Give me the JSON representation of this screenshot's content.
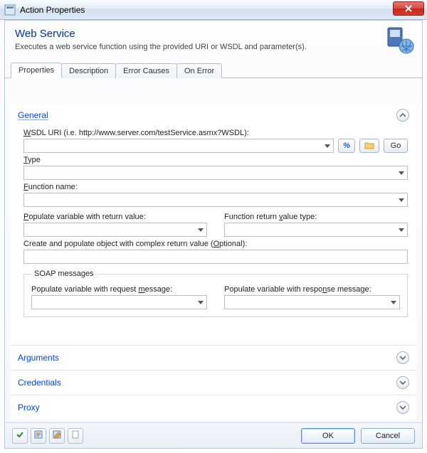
{
  "window": {
    "title": "Action Properties"
  },
  "header": {
    "title": "Web Service",
    "description": "Executes a web service function using the provided URI or WSDL and parameter(s)."
  },
  "tabs": [
    "Properties",
    "Description",
    "Error Causes",
    "On Error"
  ],
  "sections": {
    "general": {
      "title": "General",
      "wsdl_label": "WSDL URI (i.e. http://www.server.com/testService.asmx?WSDL):",
      "wsdl_value": "",
      "percent_icon": "%",
      "go_label": "Go",
      "type_label": "Type",
      "type_value": "",
      "function_label": "Function name:",
      "function_value": "",
      "populate_return_label": "Populate variable with return value:",
      "populate_return_value": "",
      "return_type_label": "Function return value type:",
      "return_type_value": "",
      "complex_label": "Create and populate object with complex return value (Optional):",
      "complex_value": "",
      "soap_legend": "SOAP messages",
      "soap_req_label": "Populate variable with request message:",
      "soap_req_value": "",
      "soap_resp_label": "Populate variable with response message:",
      "soap_resp_value": ""
    },
    "arguments": {
      "title": "Arguments"
    },
    "credentials": {
      "title": "Credentials"
    },
    "proxy": {
      "title": "Proxy"
    }
  },
  "footer": {
    "ok": "OK",
    "cancel": "Cancel"
  }
}
